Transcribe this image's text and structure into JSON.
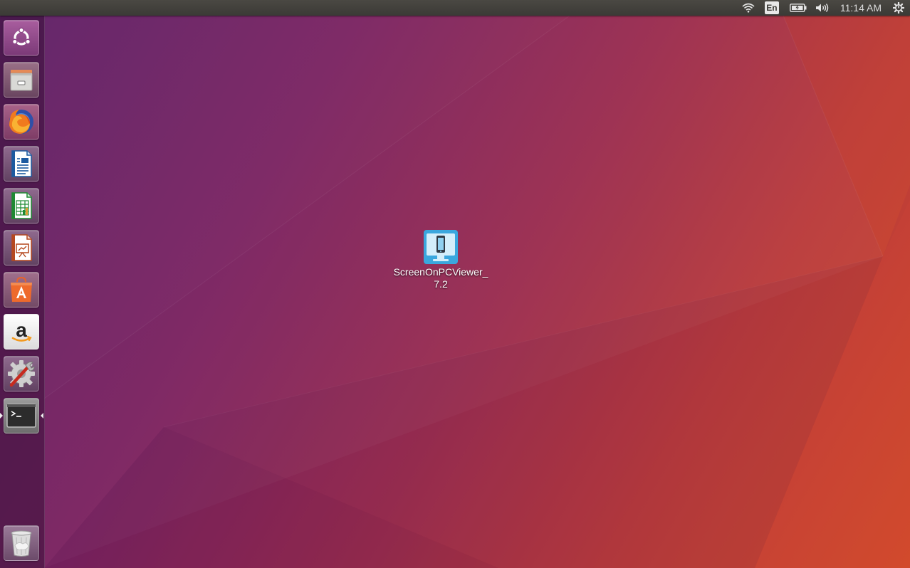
{
  "top_panel": {
    "wifi_icon": "wifi-icon",
    "keyboard_layout": "En",
    "battery_icon": "battery-icon",
    "volume_icon": "volume-icon",
    "clock": "11:14 AM",
    "power_icon": "power-gear-icon"
  },
  "launcher": {
    "items": [
      {
        "name": "dash-home",
        "icon": "ubuntu-logo-icon"
      },
      {
        "name": "files",
        "icon": "file-cabinet-icon"
      },
      {
        "name": "firefox",
        "icon": "firefox-icon"
      },
      {
        "name": "libreoffice-writer",
        "icon": "writer-document-icon"
      },
      {
        "name": "libreoffice-calc",
        "icon": "calc-spreadsheet-icon"
      },
      {
        "name": "libreoffice-impress",
        "icon": "impress-presentation-icon"
      },
      {
        "name": "ubuntu-software",
        "icon": "software-bag-icon"
      },
      {
        "name": "amazon",
        "icon": "amazon-icon"
      },
      {
        "name": "system-settings",
        "icon": "settings-wrench-icon"
      },
      {
        "name": "terminal",
        "icon": "terminal-icon",
        "running": true
      }
    ],
    "trash": {
      "name": "trash",
      "icon": "trash-icon"
    }
  },
  "desktop": {
    "icons": [
      {
        "label": "ScreenOnPCViewer_7.2",
        "icon": "monitor-phone-icon"
      }
    ]
  },
  "colors": {
    "panel": "#3b3a36",
    "wallpaper_left": "#5c1f66",
    "wallpaper_right": "#cf4a2c"
  }
}
